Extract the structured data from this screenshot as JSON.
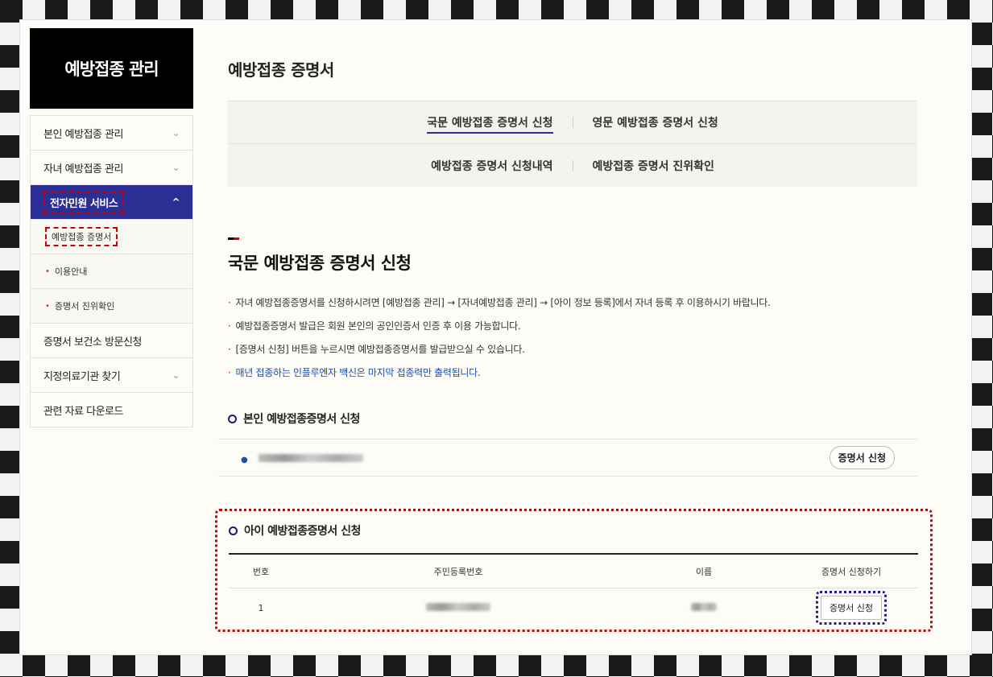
{
  "sidebar": {
    "title": "예방접종 관리",
    "items": [
      {
        "label": "본인 예방접종 관리",
        "chevron": "⌄"
      },
      {
        "label": "자녀 예방접종 관리",
        "chevron": "⌄"
      },
      {
        "label": "전자민원 서비스",
        "chevron": "^"
      }
    ],
    "subitems": [
      {
        "label": "예방접종 증명서"
      },
      {
        "label": "이용안내"
      },
      {
        "label": "증명서 진위확인"
      }
    ],
    "items2": [
      {
        "label": "증명서 보건소 방문신청",
        "chevron": ""
      },
      {
        "label": "지정의료기관 찾기",
        "chevron": "⌄"
      },
      {
        "label": "관련 자료 다운로드",
        "chevron": ""
      }
    ]
  },
  "main": {
    "page_title": "예방접종 증명서",
    "tabs": [
      {
        "label": "국문 예방접종 증명서 신청"
      },
      {
        "label": "영문 예방접종 증명서 신청"
      },
      {
        "label": "예방접종 증명서 신청내역"
      },
      {
        "label": "예방접종 증명서 진위확인"
      }
    ],
    "section_title": "국문 예방접종 증명서 신청",
    "notes": [
      "자녀 예방접종증명서를 신청하시려면 [예방접종 관리] → [자녀예방접종 관리] → [아이 정보 등록]에서 자녀 등록 후 이용하시기 바랍니다.",
      "예방접종증명서 발급은 회원 본인의 공인인증서 인증 후 이용 가능합니다.",
      "[증명서 신청] 버튼을 누르시면 예방접종증명서를 발급받으실 수 있습니다.",
      "매년 접종하는 인플루엔자 백신은 마지막 접종력만 출력됩니다."
    ],
    "self": {
      "title": "본인 예방접종증명서 신청",
      "button": "증명서 신청"
    },
    "kid": {
      "title": "아이 예방접종증명서 신청",
      "headers": [
        "번호",
        "주민등록번호",
        "이름",
        "증명서 신청하기"
      ],
      "row": {
        "no": "1",
        "button": "증명서 신청"
      }
    }
  }
}
